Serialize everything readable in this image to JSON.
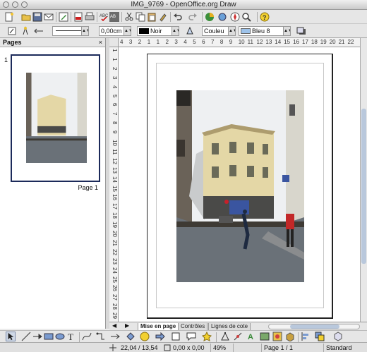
{
  "window": {
    "title": "IMG_9769 - OpenOffice.org Draw"
  },
  "line_props": {
    "width_value": "0,00cm",
    "color_value": "Noir",
    "fill_type": "Couleu",
    "fill_color": "Bleu 8"
  },
  "pages_panel": {
    "title": "Pages",
    "close": "×",
    "page_number": "1",
    "page_label": "Page 1"
  },
  "rulers": {
    "h_ticks": [
      "4",
      "3",
      "2",
      "1",
      "1",
      "2",
      "3",
      "4",
      "5",
      "6",
      "7",
      "8",
      "9",
      "10",
      "11",
      "12",
      "13",
      "14",
      "15",
      "16",
      "17",
      "18",
      "19",
      "20",
      "21",
      "22"
    ],
    "v_ticks": [
      "1",
      "1",
      "2",
      "3",
      "4",
      "5",
      "6",
      "7",
      "8",
      "9",
      "10",
      "11",
      "12",
      "13",
      "14",
      "15",
      "16",
      "17",
      "18",
      "19",
      "20",
      "21",
      "22",
      "23",
      "24",
      "25",
      "26",
      "27",
      "28",
      "29"
    ]
  },
  "tabs": [
    {
      "label": "Mise en page"
    },
    {
      "label": "Contrôles"
    },
    {
      "label": "Lignes de cote"
    }
  ],
  "status": {
    "position": "22,04 / 13,54",
    "size": "0,00 x 0,00",
    "zoom": "49%",
    "page": "Page 1 / 1",
    "style": "Standard"
  },
  "colors": {
    "sky": "#eef0f2",
    "building": "#e4d7a6",
    "road": "#6a7178",
    "shadow": "#3e3a34",
    "frame": "#1c2a5a"
  }
}
